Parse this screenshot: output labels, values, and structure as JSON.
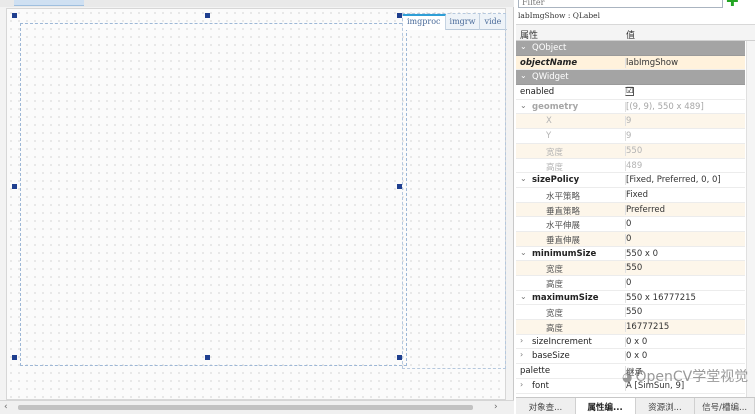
{
  "designer": {
    "tabs": [
      "imgproc",
      "imgrw",
      "vide"
    ]
  },
  "property_editor": {
    "filter_placeholder": "Filter",
    "object_info": "labImgShow : QLabel",
    "col_property": "属性",
    "col_value": "值",
    "rows": [
      {
        "kind": "cat",
        "name": "QObject",
        "value": ""
      },
      {
        "kind": "obj",
        "name": "objectName",
        "value": "labImgShow"
      },
      {
        "kind": "cat",
        "name": "QWidget",
        "value": ""
      },
      {
        "kind": "plain",
        "name": "enabled",
        "value": "☑"
      },
      {
        "kind": "grp-dim",
        "name": "geometry",
        "value": "[(9, 9), 550 x 489]"
      },
      {
        "kind": "sub-dim",
        "name": "X",
        "value": "9"
      },
      {
        "kind": "sub-dim",
        "name": "Y",
        "value": "9"
      },
      {
        "kind": "sub-dim",
        "name": "宽度",
        "value": "550"
      },
      {
        "kind": "sub-dim",
        "name": "高度",
        "value": "489"
      },
      {
        "kind": "grp",
        "name": "sizePolicy",
        "value": "[Fixed, Preferred, 0, 0]"
      },
      {
        "kind": "sub",
        "name": "水平策略",
        "value": "Fixed"
      },
      {
        "kind": "sub",
        "name": "垂直策略",
        "value": "Preferred"
      },
      {
        "kind": "sub",
        "name": "水平伸展",
        "value": "0"
      },
      {
        "kind": "sub",
        "name": "垂直伸展",
        "value": "0"
      },
      {
        "kind": "grp",
        "name": "minimumSize",
        "value": "550 x 0"
      },
      {
        "kind": "sub",
        "name": "宽度",
        "value": "550"
      },
      {
        "kind": "sub",
        "name": "高度",
        "value": "0"
      },
      {
        "kind": "grp",
        "name": "maximumSize",
        "value": "550 x 16777215"
      },
      {
        "kind": "sub",
        "name": "宽度",
        "value": "550"
      },
      {
        "kind": "sub",
        "name": "高度",
        "value": "16777215"
      },
      {
        "kind": "collapsed",
        "name": "sizeIncrement",
        "value": "0 x 0"
      },
      {
        "kind": "collapsed",
        "name": "baseSize",
        "value": "0 x 0"
      },
      {
        "kind": "plain",
        "name": "palette",
        "value": "继承"
      },
      {
        "kind": "collapsed",
        "name": "font",
        "value": "A  [SimSun, 9]"
      }
    ]
  },
  "watermark": {
    "text": "OpenCV学堂视觉"
  },
  "bottom_tabs": [
    "对象查...",
    "属性编...",
    "资源浏...",
    "信号/槽编..."
  ],
  "active_bottom_tab": 1
}
